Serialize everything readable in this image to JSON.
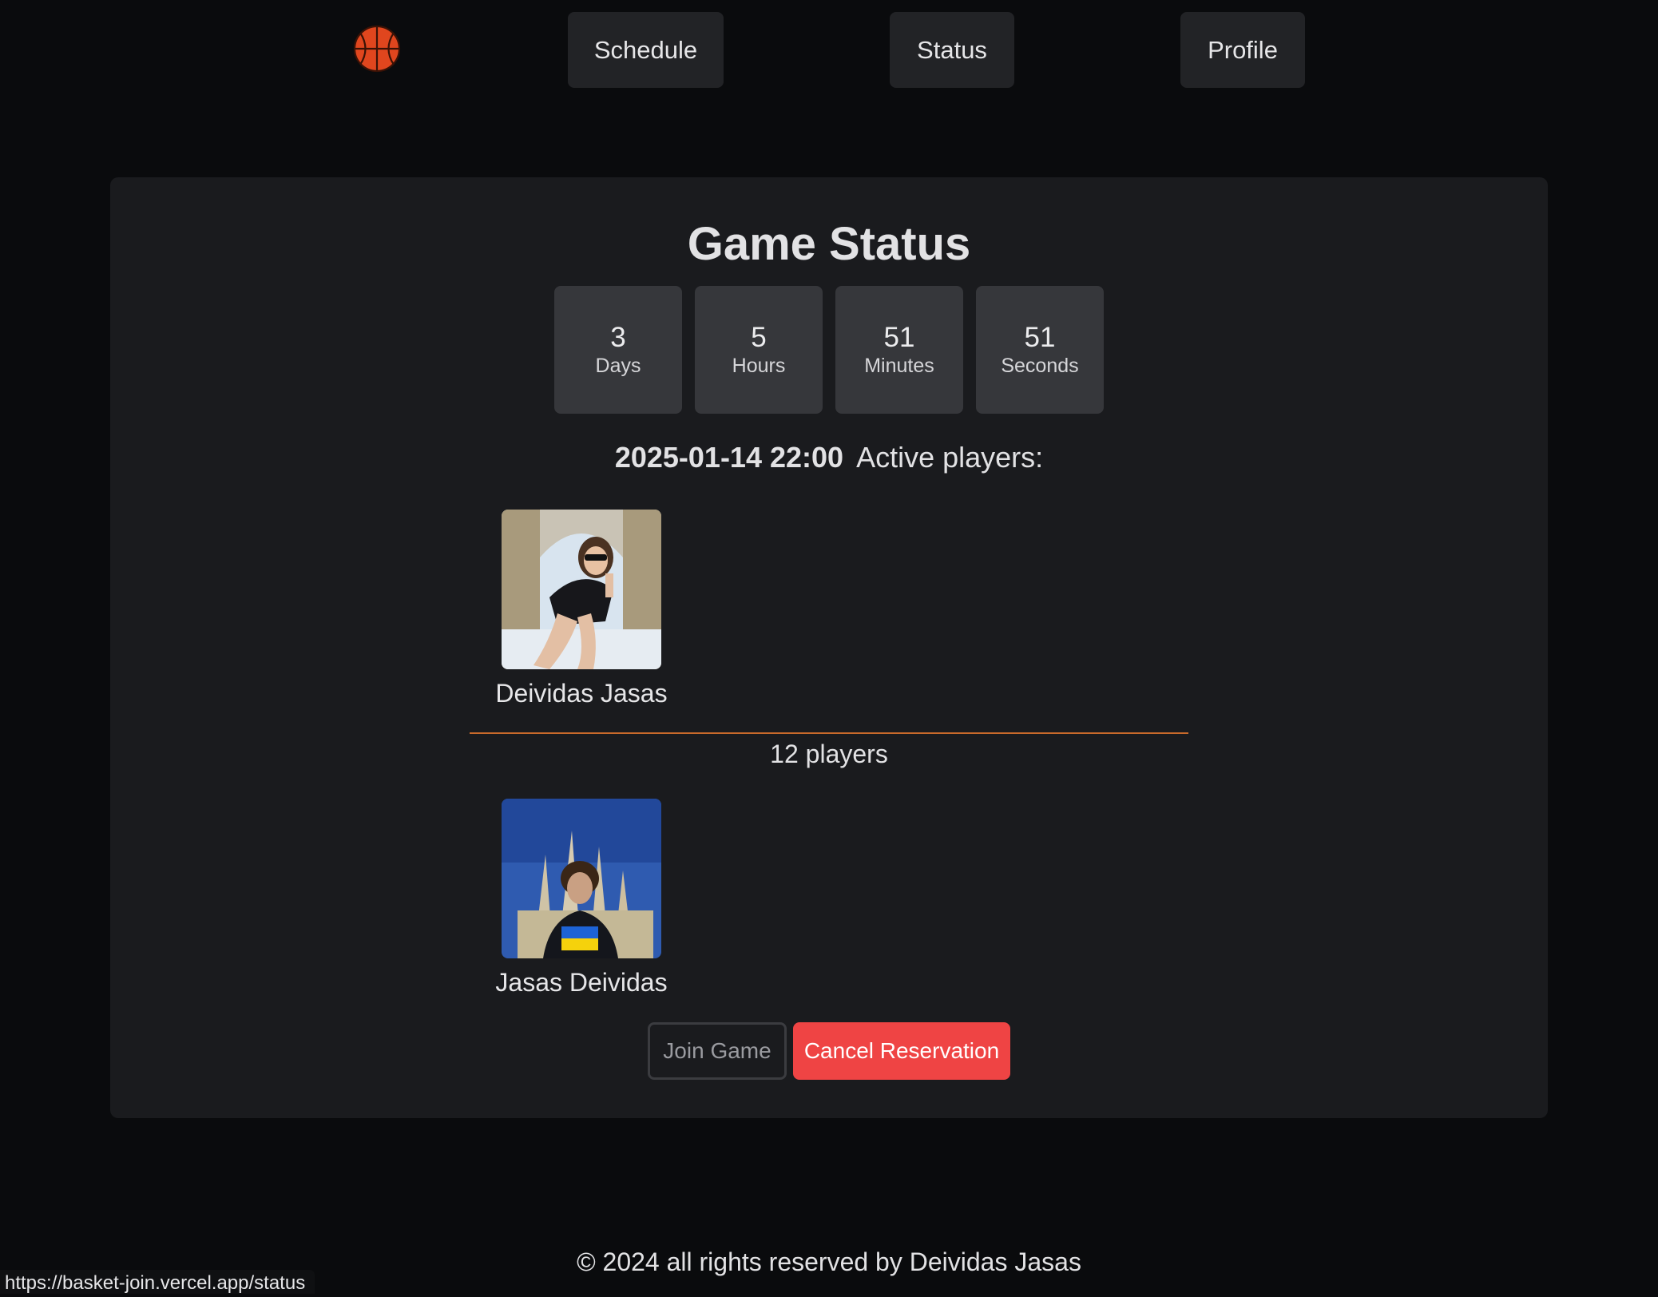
{
  "nav": {
    "logo_icon": "basketball-icon",
    "items": [
      {
        "label": "Schedule"
      },
      {
        "label": "Status"
      },
      {
        "label": "Profile"
      }
    ]
  },
  "status": {
    "title": "Game Status",
    "countdown": [
      {
        "value": "3",
        "label": "Days"
      },
      {
        "value": "5",
        "label": "Hours"
      },
      {
        "value": "51",
        "label": "Minutes"
      },
      {
        "value": "51",
        "label": "Seconds"
      }
    ],
    "date": "2025-01-14 22:00",
    "active_players_label": "Active players:",
    "players": [
      {
        "name": "Deividas Jasas"
      },
      {
        "name": "Jasas Deividas"
      }
    ],
    "players_count": "12 players",
    "join_label": "Join Game",
    "cancel_label": "Cancel Reservation"
  },
  "footer": {
    "text": "© 2024 all rights reserved by Deividas Jasas"
  },
  "status_bar": {
    "url": "https://basket-join.vercel.app/status"
  },
  "colors": {
    "background": "#0a0b0d",
    "card": "#1a1b1e",
    "nav_button": "#222326",
    "countdown_box": "#36373b",
    "divider": "#c96a2b",
    "cancel_button": "#ef4444",
    "logo": "#e0461e"
  }
}
